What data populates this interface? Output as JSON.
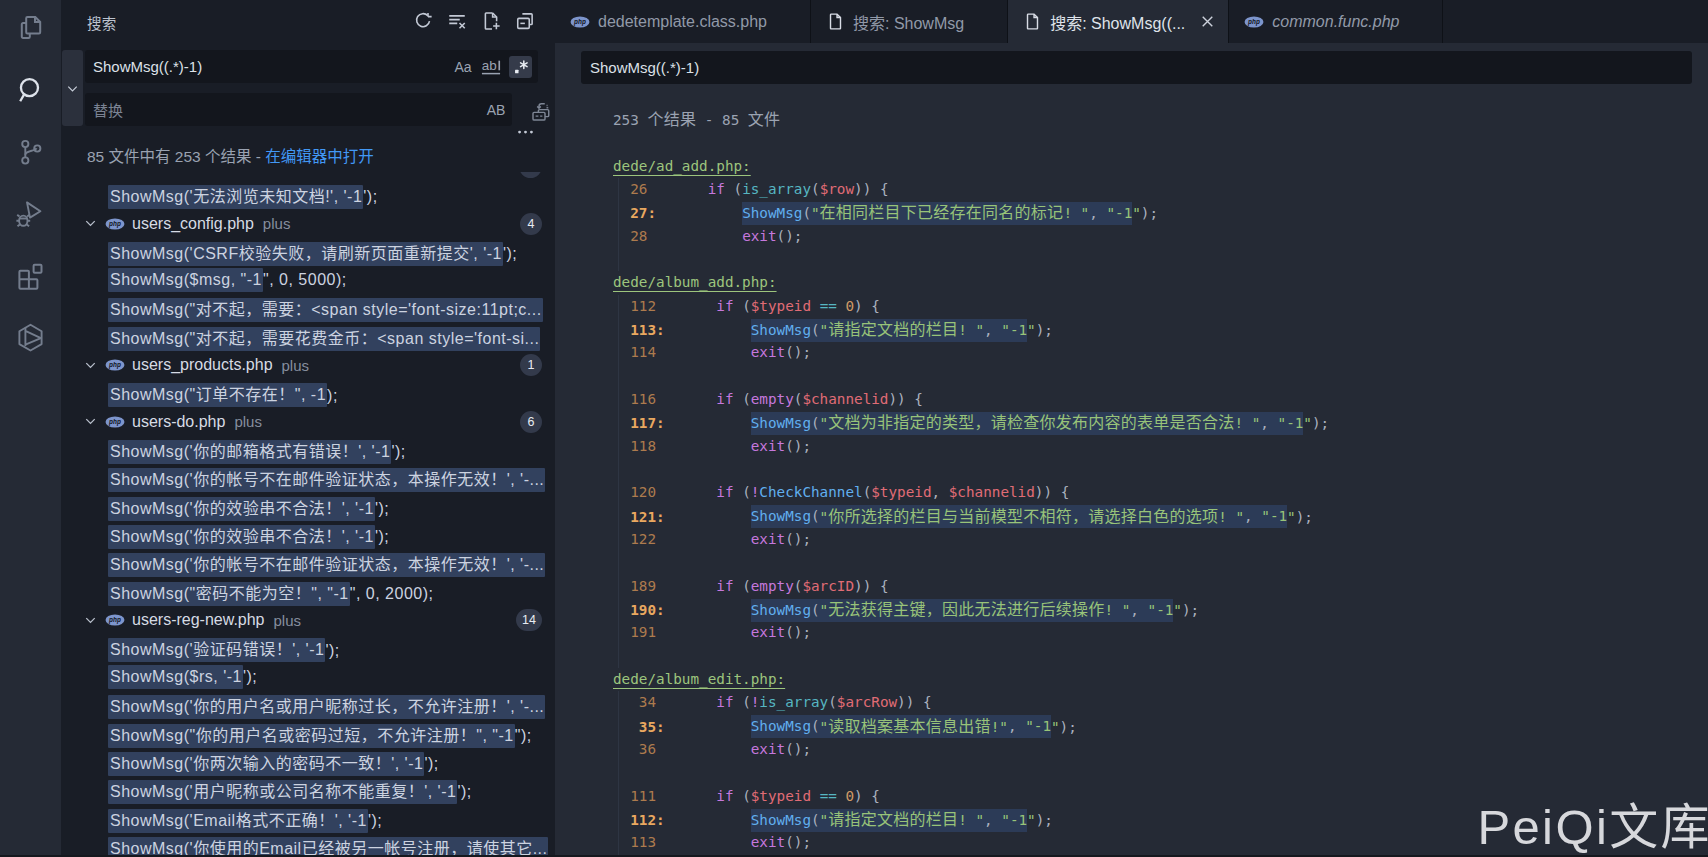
{
  "colors": {
    "activity_bg": "#252a35",
    "sidebar_bg": "#191d26",
    "editor_bg": "#252a35",
    "input_bg": "#13161d",
    "match_highlight_sidebar": "#32415e",
    "match_highlight_editor": "#2c3b57",
    "link": "#4298f5",
    "string": "#98c379",
    "keyword": "#c678dd",
    "function": "#61afef",
    "variable": "#e06c75",
    "number": "#d19a66",
    "operator": "#56b6c2",
    "line_number": "#ad7b4e",
    "matched_line_number": "#e9a860"
  },
  "watermark": "PeiQi文库",
  "activity_bar": {
    "items": [
      {
        "icon": "files-icon",
        "active": false
      },
      {
        "icon": "search-icon",
        "active": true
      },
      {
        "icon": "source-control-icon",
        "active": false
      },
      {
        "icon": "run-debug-icon",
        "active": false
      },
      {
        "icon": "extensions-icon",
        "active": false
      },
      {
        "icon": "package-icon",
        "active": false
      }
    ]
  },
  "sidebar": {
    "title": "搜索",
    "actions": [
      {
        "icon": "refresh-icon",
        "label": "刷新"
      },
      {
        "icon": "clear-results-icon",
        "label": "清除搜索结果"
      },
      {
        "icon": "new-search-editor-icon",
        "label": "打开新的搜索编辑器"
      },
      {
        "icon": "collapse-all-icon",
        "label": "全部折叠"
      }
    ],
    "toggle_replace_icon": "chevron-down-icon",
    "search": {
      "value": "ShowMsg((.*)-1)",
      "match_case_label": "Aa",
      "whole_word_label": "ab",
      "regex_label": ".*",
      "regex_active": true
    },
    "replace": {
      "placeholder": "替换",
      "preserve_case_label": "AB",
      "replace_all_icon": "replace-all-icon"
    },
    "more_icon": "more-icon",
    "summary": {
      "text": "85 文件中有 253 个结果 - ",
      "link": "在编辑器中打开"
    },
    "tree": [
      {
        "k": "m",
        "hl": "ShowMsg('无法浏览未知文档!', '-1",
        "tail": "');"
      },
      {
        "k": "f",
        "name": "users_config.php",
        "dir": "plus",
        "badge": "4"
      },
      {
        "k": "m",
        "hl": "ShowMsg('CSRF校验失败，请刷新页面重新提交', '-1",
        "tail": "');"
      },
      {
        "k": "m",
        "hl": "ShowMsg($msg, \"-1",
        "tail": "\", 0, 5000);"
      },
      {
        "k": "m",
        "hl": "ShowMsg(\"对不起，需要：<span style='font-size:11pt;c...",
        "tail": ""
      },
      {
        "k": "m",
        "hl": "ShowMsg(\"对不起，需要花费金币：<span style='font-si...",
        "tail": ""
      },
      {
        "k": "f",
        "name": "users_products.php",
        "dir": "plus",
        "badge": "1"
      },
      {
        "k": "m",
        "hl": "ShowMsg(\"订单不存在！\", -1",
        "tail": ");"
      },
      {
        "k": "f",
        "name": "users-do.php",
        "dir": "plus",
        "badge": "6"
      },
      {
        "k": "m",
        "hl": "ShowMsg('你的邮箱格式有错误！', '-1",
        "tail": "');"
      },
      {
        "k": "m",
        "hl": "ShowMsg('你的帐号不在邮件验证状态，本操作无效！', '-...",
        "tail": ""
      },
      {
        "k": "m",
        "hl": "ShowMsg('你的效验串不合法！', '-1",
        "tail": "');"
      },
      {
        "k": "m",
        "hl": "ShowMsg('你的效验串不合法！', '-1",
        "tail": "');"
      },
      {
        "k": "m",
        "hl": "ShowMsg('你的帐号不在邮件验证状态，本操作无效！', '-...",
        "tail": ""
      },
      {
        "k": "m",
        "hl": "ShowMsg(\"密码不能为空！\", \"-1",
        "tail": "\", 0, 2000);"
      },
      {
        "k": "f",
        "name": "users-reg-new.php",
        "dir": "plus",
        "badge": "14"
      },
      {
        "k": "m",
        "hl": "ShowMsg('验证码错误！', '-1",
        "tail": "');"
      },
      {
        "k": "m",
        "hl": "ShowMsg($rs, '-1",
        "tail": "');"
      },
      {
        "k": "m",
        "hl": "ShowMsg('你的用户名或用户昵称过长，不允许注册！', '-...",
        "tail": ""
      },
      {
        "k": "m",
        "hl": "ShowMsg(\"你的用户名或密码过短，不允许注册！\", \"-1",
        "tail": "\");"
      },
      {
        "k": "m",
        "hl": "ShowMsg('你两次输入的密码不一致！', '-1",
        "tail": "');"
      },
      {
        "k": "m",
        "hl": "ShowMsg('用户昵称或公司名称不能重复！', '-1",
        "tail": "');"
      },
      {
        "k": "m",
        "hl": "ShowMsg('Email格式不正确！', '-1",
        "tail": "');"
      },
      {
        "k": "m",
        "hl": "ShowMsg('你使用的Email已经被另一帐号注册，请使其它...",
        "tail": ""
      }
    ]
  },
  "tabs": [
    {
      "icon": "php-icon",
      "label": "dedetemplate.class.php",
      "active": false,
      "italic": false,
      "close": false
    },
    {
      "icon": "file-icon",
      "label": "搜索: ShowMsg",
      "active": false,
      "italic": false,
      "close": false
    },
    {
      "icon": "file-icon",
      "label": "搜索: ShowMsg((...",
      "active": true,
      "italic": false,
      "close": true
    },
    {
      "icon": "php-icon",
      "label": "common.func.php",
      "active": false,
      "italic": true,
      "close": false
    }
  ],
  "editor": {
    "query": "ShowMsg((.*)-1)",
    "summary": "253 个结果 - 85 文件",
    "lines": [
      {
        "t": "sum"
      },
      {
        "t": "blank"
      },
      {
        "t": "head",
        "text": "dede/ad_add.php:"
      },
      {
        "t": "code",
        "num": "26",
        "w": 2,
        "ind": 4,
        "tok": [
          [
            "k",
            "if"
          ],
          [
            "p",
            " ("
          ],
          [
            "cy",
            "is_array"
          ],
          [
            "p",
            "("
          ],
          [
            "v",
            "$row"
          ],
          [
            "p",
            ")) {"
          ]
        ]
      },
      {
        "t": "code",
        "num": "27",
        "w": 2,
        "m": 1,
        "ind": 8,
        "hl": [
          [
            "f",
            "ShowMsg"
          ],
          [
            "p",
            "("
          ],
          [
            "s",
            "\"在相同栏目下已经存在同名的标记! \""
          ],
          [
            "p",
            ","
          ],
          [
            "s",
            " \"-1"
          ]
        ],
        "tok": [
          [
            "s",
            "\""
          ],
          [
            "p",
            ");"
          ]
        ]
      },
      {
        "t": "code",
        "num": "28",
        "w": 2,
        "ind": 8,
        "tok": [
          [
            "k",
            "exit"
          ],
          [
            "p",
            "();"
          ]
        ]
      },
      {
        "t": "blank",
        "g": 1
      },
      {
        "t": "head",
        "text": "dede/album_add.php:"
      },
      {
        "t": "code",
        "num": "112",
        "w": 3,
        "ind": 4,
        "tok": [
          [
            "k",
            "if"
          ],
          [
            "p",
            " ("
          ],
          [
            "v",
            "$typeid"
          ],
          [
            "p",
            " "
          ],
          [
            "cy",
            "=="
          ],
          [
            "p",
            " "
          ],
          [
            "n",
            "0"
          ],
          [
            "p",
            ") {"
          ]
        ]
      },
      {
        "t": "code",
        "num": "113",
        "w": 3,
        "m": 1,
        "ind": 8,
        "hl": [
          [
            "f",
            "ShowMsg"
          ],
          [
            "p",
            "("
          ],
          [
            "s",
            "\"请指定文档的栏目! \""
          ],
          [
            "p",
            ","
          ],
          [
            "s",
            " \"-1"
          ]
        ],
        "tok": [
          [
            "s",
            "\""
          ],
          [
            "p",
            ");"
          ]
        ]
      },
      {
        "t": "code",
        "num": "114",
        "w": 3,
        "ind": 8,
        "tok": [
          [
            "k",
            "exit"
          ],
          [
            "p",
            "();"
          ]
        ]
      },
      {
        "t": "blank",
        "g": 1
      },
      {
        "t": "code",
        "num": "116",
        "w": 3,
        "ind": 4,
        "tok": [
          [
            "k",
            "if"
          ],
          [
            "p",
            " ("
          ],
          [
            "k",
            "empty"
          ],
          [
            "p",
            "("
          ],
          [
            "v",
            "$channelid"
          ],
          [
            "p",
            ")) {"
          ]
        ]
      },
      {
        "t": "code",
        "num": "117",
        "w": 3,
        "m": 1,
        "ind": 8,
        "hl": [
          [
            "f",
            "ShowMsg"
          ],
          [
            "p",
            "("
          ],
          [
            "s",
            "\"文档为非指定的类型，请检查你发布内容的表单是否合法! \""
          ],
          [
            "p",
            ","
          ],
          [
            "s",
            " \"-1"
          ]
        ],
        "tok": [
          [
            "s",
            "\""
          ],
          [
            "p",
            ");"
          ]
        ]
      },
      {
        "t": "code",
        "num": "118",
        "w": 3,
        "ind": 8,
        "tok": [
          [
            "k",
            "exit"
          ],
          [
            "p",
            "();"
          ]
        ]
      },
      {
        "t": "blank",
        "g": 1
      },
      {
        "t": "code",
        "num": "120",
        "w": 3,
        "ind": 4,
        "tok": [
          [
            "k",
            "if"
          ],
          [
            "p",
            " ("
          ],
          [
            "k",
            "!"
          ],
          [
            "f",
            "CheckChannel"
          ],
          [
            "p",
            "("
          ],
          [
            "v",
            "$typeid"
          ],
          [
            "p",
            ", "
          ],
          [
            "v",
            "$channelid"
          ],
          [
            "p",
            ")) {"
          ]
        ]
      },
      {
        "t": "code",
        "num": "121",
        "w": 3,
        "m": 1,
        "ind": 8,
        "hl": [
          [
            "f",
            "ShowMsg"
          ],
          [
            "p",
            "("
          ],
          [
            "s",
            "\"你所选择的栏目与当前模型不相符，请选择白色的选项! \""
          ],
          [
            "p",
            ","
          ],
          [
            "s",
            " \"-1"
          ]
        ],
        "tok": [
          [
            "s",
            "\""
          ],
          [
            "p",
            ");"
          ]
        ]
      },
      {
        "t": "code",
        "num": "122",
        "w": 3,
        "ind": 8,
        "tok": [
          [
            "k",
            "exit"
          ],
          [
            "p",
            "();"
          ]
        ]
      },
      {
        "t": "blank",
        "g": 1
      },
      {
        "t": "code",
        "num": "189",
        "w": 3,
        "ind": 4,
        "tok": [
          [
            "k",
            "if"
          ],
          [
            "p",
            " ("
          ],
          [
            "k",
            "empty"
          ],
          [
            "p",
            "("
          ],
          [
            "v",
            "$arcID"
          ],
          [
            "p",
            ")) {"
          ]
        ]
      },
      {
        "t": "code",
        "num": "190",
        "w": 3,
        "m": 1,
        "ind": 8,
        "hl": [
          [
            "f",
            "ShowMsg"
          ],
          [
            "p",
            "("
          ],
          [
            "s",
            "\"无法获得主键，因此无法进行后续操作! \""
          ],
          [
            "p",
            ","
          ],
          [
            "s",
            " \"-1"
          ]
        ],
        "tok": [
          [
            "s",
            "\""
          ],
          [
            "p",
            ");"
          ]
        ]
      },
      {
        "t": "code",
        "num": "191",
        "w": 3,
        "ind": 8,
        "tok": [
          [
            "k",
            "exit"
          ],
          [
            "p",
            "();"
          ]
        ]
      },
      {
        "t": "blank",
        "g": 1
      },
      {
        "t": "head",
        "text": "dede/album_edit.php:"
      },
      {
        "t": "code",
        "num": "34",
        "w": 3,
        "ind": 4,
        "tok": [
          [
            "k",
            "if"
          ],
          [
            "p",
            " ("
          ],
          [
            "k",
            "!"
          ],
          [
            "cy",
            "is_array"
          ],
          [
            "p",
            "("
          ],
          [
            "v",
            "$arcRow"
          ],
          [
            "p",
            ")) {"
          ]
        ]
      },
      {
        "t": "code",
        "num": "35",
        "w": 3,
        "m": 1,
        "ind": 8,
        "hl": [
          [
            "f",
            "ShowMsg"
          ],
          [
            "p",
            "("
          ],
          [
            "s",
            "\"读取档案基本信息出错!\""
          ],
          [
            "p",
            ","
          ],
          [
            "s",
            " \"-1"
          ]
        ],
        "tok": [
          [
            "s",
            "\""
          ],
          [
            "p",
            ");"
          ]
        ]
      },
      {
        "t": "code",
        "num": "36",
        "w": 3,
        "ind": 8,
        "tok": [
          [
            "k",
            "exit"
          ],
          [
            "p",
            "();"
          ]
        ]
      },
      {
        "t": "blank",
        "g": 1
      },
      {
        "t": "code",
        "num": "111",
        "w": 3,
        "ind": 4,
        "tok": [
          [
            "k",
            "if"
          ],
          [
            "p",
            " ("
          ],
          [
            "v",
            "$typeid"
          ],
          [
            "p",
            " "
          ],
          [
            "cy",
            "=="
          ],
          [
            "p",
            " "
          ],
          [
            "n",
            "0"
          ],
          [
            "p",
            ") {"
          ]
        ]
      },
      {
        "t": "code",
        "num": "112",
        "w": 3,
        "m": 1,
        "ind": 8,
        "hl": [
          [
            "f",
            "ShowMsg"
          ],
          [
            "p",
            "("
          ],
          [
            "s",
            "\"请指定文档的栏目! \""
          ],
          [
            "p",
            ","
          ],
          [
            "s",
            " \"-1"
          ]
        ],
        "tok": [
          [
            "s",
            "\""
          ],
          [
            "p",
            ");"
          ]
        ]
      },
      {
        "t": "code",
        "num": "113",
        "w": 3,
        "ind": 8,
        "tok": [
          [
            "k",
            "exit"
          ],
          [
            "p",
            "();"
          ]
        ]
      }
    ]
  }
}
